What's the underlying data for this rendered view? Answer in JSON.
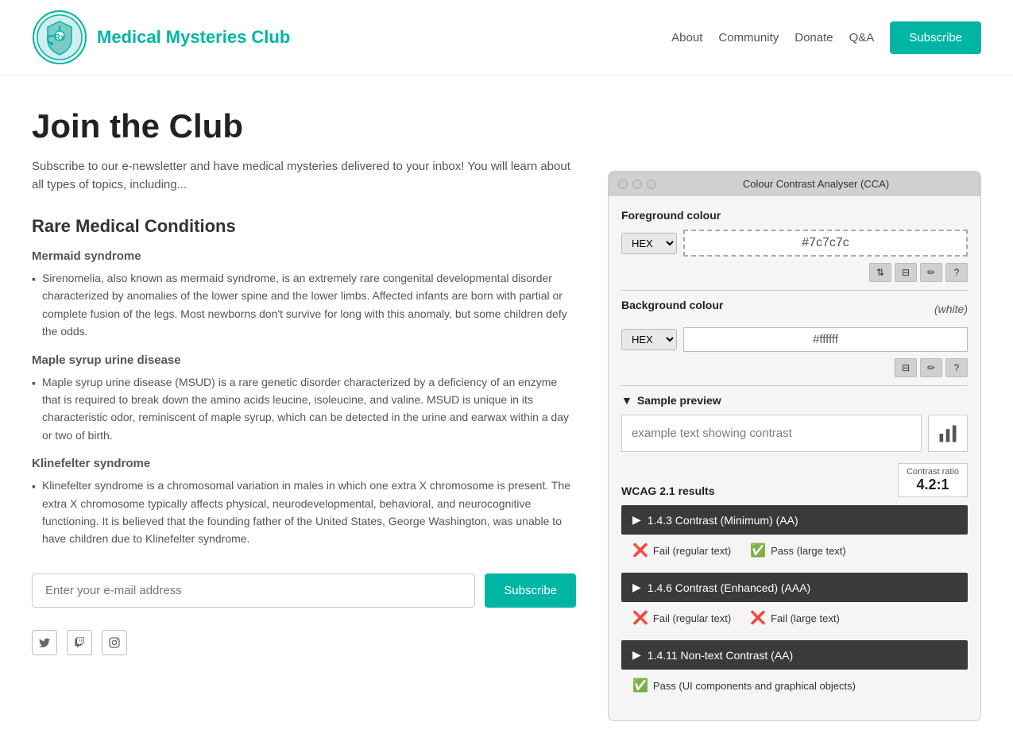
{
  "header": {
    "logo_text": "Medical Mysteries Club",
    "nav": {
      "about": "About",
      "community": "Community",
      "donate": "Donate",
      "qa": "Q&A",
      "subscribe": "Subscribe"
    }
  },
  "main": {
    "page_title": "Join the Club",
    "intro": "Subscribe to our e-newsletter and have medical mysteries delivered to your inbox! You will learn about all types of topics, including...",
    "section_title": "Rare Medical Conditions",
    "conditions": [
      {
        "title": "Mermaid syndrome",
        "description": "Sirenomelia, also known as mermaid syndrome, is an extremely rare congenital developmental disorder characterized by anomalies of the lower spine and the lower limbs. Affected infants are born with partial or complete fusion of the legs. Most newborns don't survive for long with this anomaly, but some children defy the odds."
      },
      {
        "title": "Maple syrup urine disease",
        "description": "Maple syrup urine disease (MSUD) is a rare genetic disorder characterized by a deficiency of an enzyme that is required to break down the amino acids leucine, isoleucine, and valine. MSUD is unique in its characteristic odor, reminiscent of maple syrup, which can be detected in the urine and earwax within a day or two of birth."
      },
      {
        "title": "Klinefelter syndrome",
        "description": "Klinefelter syndrome is a chromosomal variation in males in which one extra X chromosome is present. The extra X chromosome typically affects physical, neurodevelopmental, behavioral, and neurocognitive functioning. It is believed that the founding father of the United States, George Washington, was unable to have children due to Klinefelter syndrome."
      }
    ],
    "email_placeholder": "Enter your e-mail address",
    "subscribe_label": "Subscribe"
  },
  "cca": {
    "title": "Colour Contrast Analyser (CCA)",
    "foreground_label": "Foreground colour",
    "fg_format": "HEX",
    "fg_value": "#7c7c7c",
    "background_label": "Background colour",
    "bg_white_label": "(white)",
    "bg_format": "HEX",
    "bg_value": "#ffffff",
    "sample_preview_label": "Sample preview",
    "example_text": "example text showing contrast",
    "wcag_label": "WCAG 2.1 results",
    "contrast_ratio_label": "Contrast ratio",
    "contrast_ratio_value": "4.2:1",
    "wcag_items": [
      {
        "id": "1.4.3",
        "label": "1.4.3 Contrast (Minimum) (AA)",
        "results": [
          {
            "pass": false,
            "text": "Fail (regular text)"
          },
          {
            "pass": true,
            "text": "Pass (large text)"
          }
        ]
      },
      {
        "id": "1.4.6",
        "label": "1.4.6 Contrast (Enhanced) (AAA)",
        "results": [
          {
            "pass": false,
            "text": "Fail (regular text)"
          },
          {
            "pass": false,
            "text": "Fail (large text)"
          }
        ]
      },
      {
        "id": "1.4.11",
        "label": "1.4.11 Non-text Contrast (AA)",
        "results": [
          {
            "pass": true,
            "text": "Pass (UI components and graphical objects)"
          }
        ]
      }
    ],
    "tools": {
      "swap": "⇅",
      "sliders": "⊟",
      "eyedropper": "✏",
      "help": "?"
    }
  }
}
